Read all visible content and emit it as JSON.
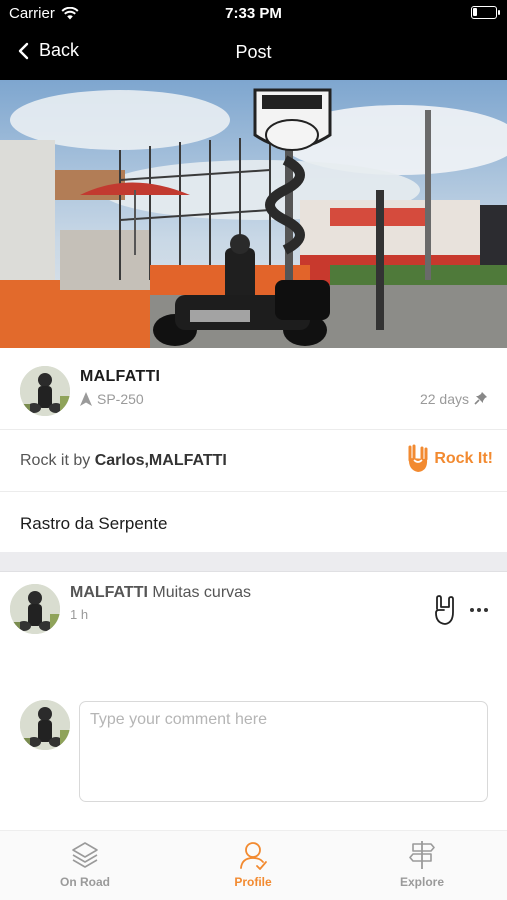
{
  "status_bar": {
    "carrier": "Carrier",
    "time": "7:33 PM",
    "battery_level": 0.2
  },
  "nav": {
    "back_label": "Back",
    "title": "Post"
  },
  "post": {
    "photo_description": "rider-with-motorcycle-at-rastro-da-serpente-sign",
    "author": "MALFATTI",
    "location": "SP-250",
    "age": "22 days",
    "rock_prefix": "Rock it by ",
    "rockers": "Carlos,MALFATTI",
    "rock_button_label": "Rock It!",
    "caption": "Rastro da Serpente"
  },
  "comments": [
    {
      "author": "MALFATTI",
      "text": "Muitas curvas",
      "time": "1 h"
    }
  ],
  "compose": {
    "placeholder": "Type your comment here"
  },
  "tab_bar": {
    "tabs": [
      {
        "label": "On Road",
        "icon": "layers-icon",
        "active": false
      },
      {
        "label": "Profile",
        "icon": "profile-icon",
        "active": true
      },
      {
        "label": "Explore",
        "icon": "signpost-icon",
        "active": false
      }
    ]
  },
  "colors": {
    "accent": "#f28a30",
    "header": "#000000"
  }
}
